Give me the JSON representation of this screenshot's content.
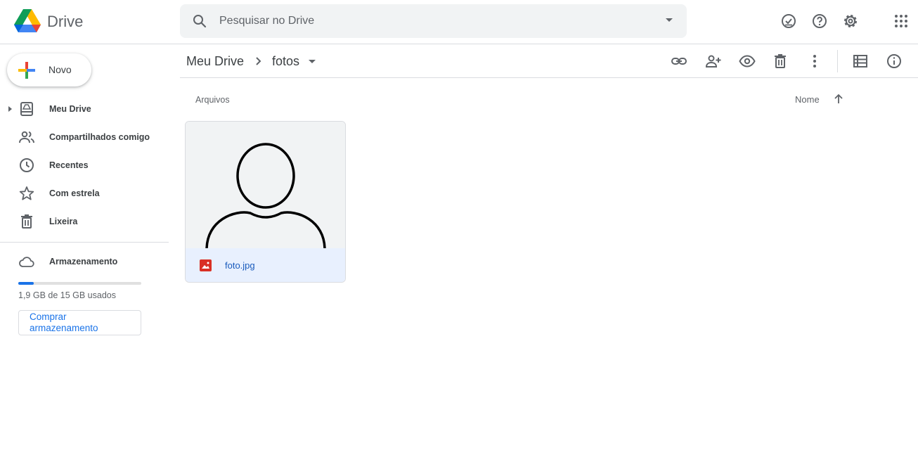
{
  "header": {
    "app_title": "Drive",
    "search": {
      "placeholder": "Pesquisar no Drive"
    },
    "icons": [
      "offline-ready-icon",
      "help-icon",
      "settings-icon",
      "apps-grid-icon"
    ]
  },
  "sidebar": {
    "new_button_label": "Novo",
    "items": [
      {
        "label": "Meu Drive",
        "icon": "my-drive-icon"
      },
      {
        "label": "Compartilhados comigo",
        "icon": "people-icon"
      },
      {
        "label": "Recentes",
        "icon": "clock-icon"
      },
      {
        "label": "Com estrela",
        "icon": "star-icon"
      },
      {
        "label": "Lixeira",
        "icon": "trash-icon"
      }
    ],
    "storage": {
      "label": "Armazenamento",
      "usage_text": "1,9 GB de 15 GB usados",
      "used_fraction": 0.127,
      "buy_label": "Comprar armazenamento"
    }
  },
  "toolbar": {
    "breadcrumb_root": "Meu Drive",
    "breadcrumb_current": "fotos",
    "icons": [
      "link-icon",
      "share-icon",
      "preview-icon",
      "delete-icon",
      "more-icon",
      "list-view-icon",
      "info-icon"
    ]
  },
  "content": {
    "section_title": "Arquivos",
    "sort_label": "Nome",
    "files": [
      {
        "name": "foto.jpg",
        "type": "image"
      }
    ]
  },
  "colors": {
    "accent": "#1a73e8",
    "selected_bg": "#e8f0fe",
    "image_type_red": "#d93025"
  }
}
